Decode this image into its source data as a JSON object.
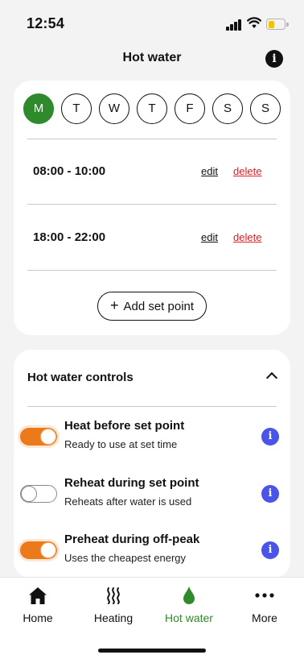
{
  "status_bar": {
    "time": "12:54"
  },
  "header": {
    "title": "Hot water"
  },
  "schedule": {
    "days": [
      {
        "label": "M",
        "active": true
      },
      {
        "label": "T",
        "active": false
      },
      {
        "label": "W",
        "active": false
      },
      {
        "label": "T",
        "active": false
      },
      {
        "label": "F",
        "active": false
      },
      {
        "label": "S",
        "active": false
      },
      {
        "label": "S",
        "active": false
      }
    ],
    "slots": [
      {
        "time": "08:00 - 10:00",
        "edit_label": "edit",
        "delete_label": "delete"
      },
      {
        "time": "18:00 - 22:00",
        "edit_label": "edit",
        "delete_label": "delete"
      }
    ],
    "add_label": "Add set point"
  },
  "controls": {
    "title": "Hot water controls",
    "items": [
      {
        "title": "Heat before set point",
        "subtitle": "Ready to use at set time",
        "enabled": true
      },
      {
        "title": "Reheat during set point",
        "subtitle": "Reheats after water is used",
        "enabled": false
      },
      {
        "title": "Preheat during off-peak",
        "subtitle": "Uses the cheapest energy",
        "enabled": true
      }
    ]
  },
  "tabs": [
    {
      "label": "Home",
      "icon": "home-icon",
      "active": false
    },
    {
      "label": "Heating",
      "icon": "heating-icon",
      "active": false
    },
    {
      "label": "Hot water",
      "icon": "water-drop-icon",
      "active": true
    },
    {
      "label": "More",
      "icon": "more-icon",
      "active": false
    }
  ],
  "colors": {
    "accent_green": "#2e8a2a",
    "toggle_on": "#ec7a1a",
    "delete_red": "#e01b24",
    "info_blue": "#4a54e8",
    "battery_yellow": "#f3c200"
  }
}
